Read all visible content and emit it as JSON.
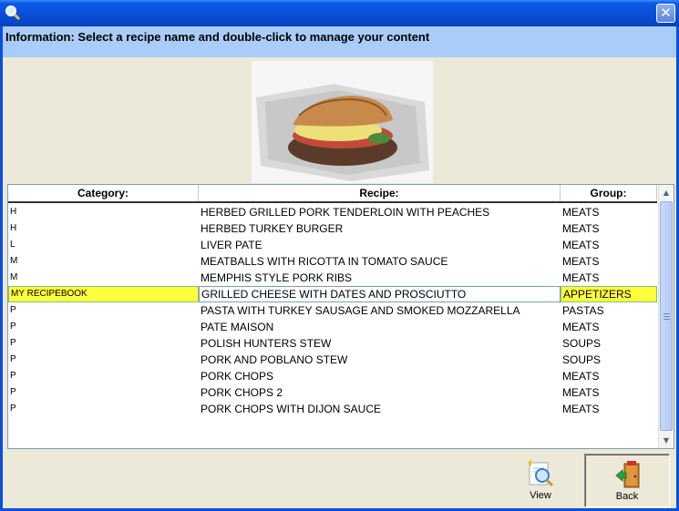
{
  "window": {
    "title_icon": "search-icon",
    "close_label": "✕"
  },
  "info": {
    "text": "Information: Select a recipe name and double-click to manage your content"
  },
  "grid": {
    "headers": {
      "category": "Category:",
      "recipe": "Recipe:",
      "group": "Group:"
    },
    "rows": [
      {
        "category": "H",
        "recipe": "HERBED GRILLED PORK TENDERLOIN WITH PEACHES",
        "group": "MEATS"
      },
      {
        "category": "H",
        "recipe": "HERBED TURKEY BURGER",
        "group": "MEATS"
      },
      {
        "category": "L",
        "recipe": "LIVER PATE",
        "group": "MEATS"
      },
      {
        "category": "M",
        "recipe": "MEATBALLS WITH RICOTTA IN TOMATO SAUCE",
        "group": "MEATS"
      },
      {
        "category": "M",
        "recipe": "MEMPHIS STYLE PORK RIBS",
        "group": "MEATS"
      },
      {
        "category": "MY RECIPEBOOK",
        "recipe": "GRILLED CHEESE WITH DATES AND PROSCIUTTO",
        "group": "APPETIZERS",
        "selected": true
      },
      {
        "category": "P",
        "recipe": "PASTA WITH TURKEY SAUSAGE AND SMOKED MOZZARELLA",
        "group": "PASTAS"
      },
      {
        "category": "P",
        "recipe": "PATE MAISON",
        "group": "MEATS"
      },
      {
        "category": "P",
        "recipe": "POLISH HUNTERS STEW",
        "group": "SOUPS"
      },
      {
        "category": "P",
        "recipe": "PORK AND POBLANO STEW",
        "group": "SOUPS"
      },
      {
        "category": "P",
        "recipe": "PORK CHOPS",
        "group": "MEATS"
      },
      {
        "category": "P",
        "recipe": "PORK CHOPS 2",
        "group": "MEATS"
      },
      {
        "category": "P",
        "recipe": "PORK CHOPS WITH DIJON SAUCE",
        "group": "MEATS"
      }
    ]
  },
  "buttons": {
    "view_label": "View",
    "back_label": "Back",
    "view_icon": "view-magnifier-icon",
    "back_icon": "exit-door-icon"
  },
  "colors": {
    "titlebar": "#0A50D8",
    "infobar": "#A9CDF8",
    "selected_row": "#FFFF3C",
    "window_bg": "#ECE9D8"
  }
}
